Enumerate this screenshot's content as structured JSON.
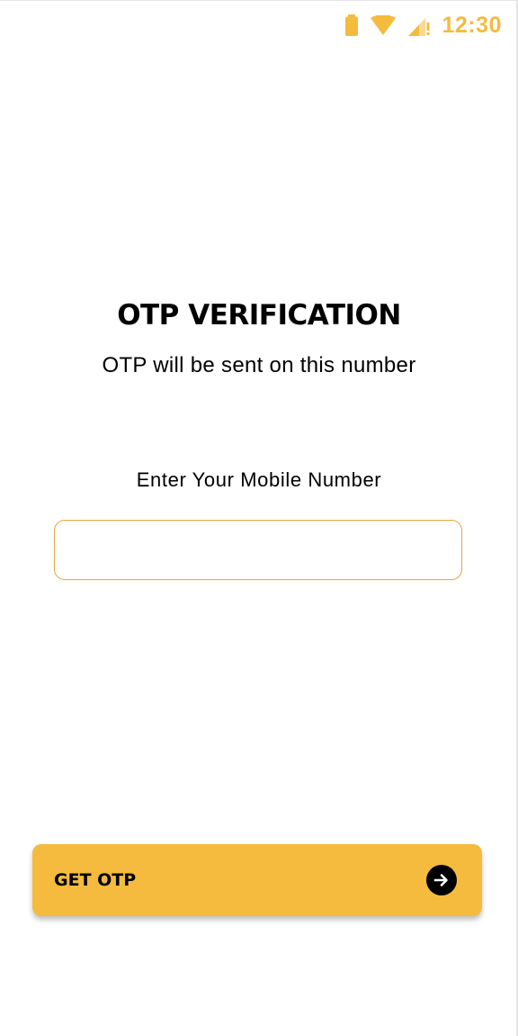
{
  "colors": {
    "accent": "#F4BB3E",
    "input_border": "#E9A63B",
    "status_icons": "#F4BB3E"
  },
  "status_bar": {
    "time": "12:30",
    "icons": [
      "battery-icon",
      "wifi-icon",
      "cellular-signal-icon"
    ]
  },
  "header": {
    "title": "OTP VERIFICATION",
    "subtitle": "OTP will be sent on this number"
  },
  "form": {
    "label": "Enter Your Mobile Number",
    "mobile_value": "",
    "mobile_placeholder": ""
  },
  "action": {
    "label": "GET OTP",
    "icon": "arrow-right-icon"
  }
}
